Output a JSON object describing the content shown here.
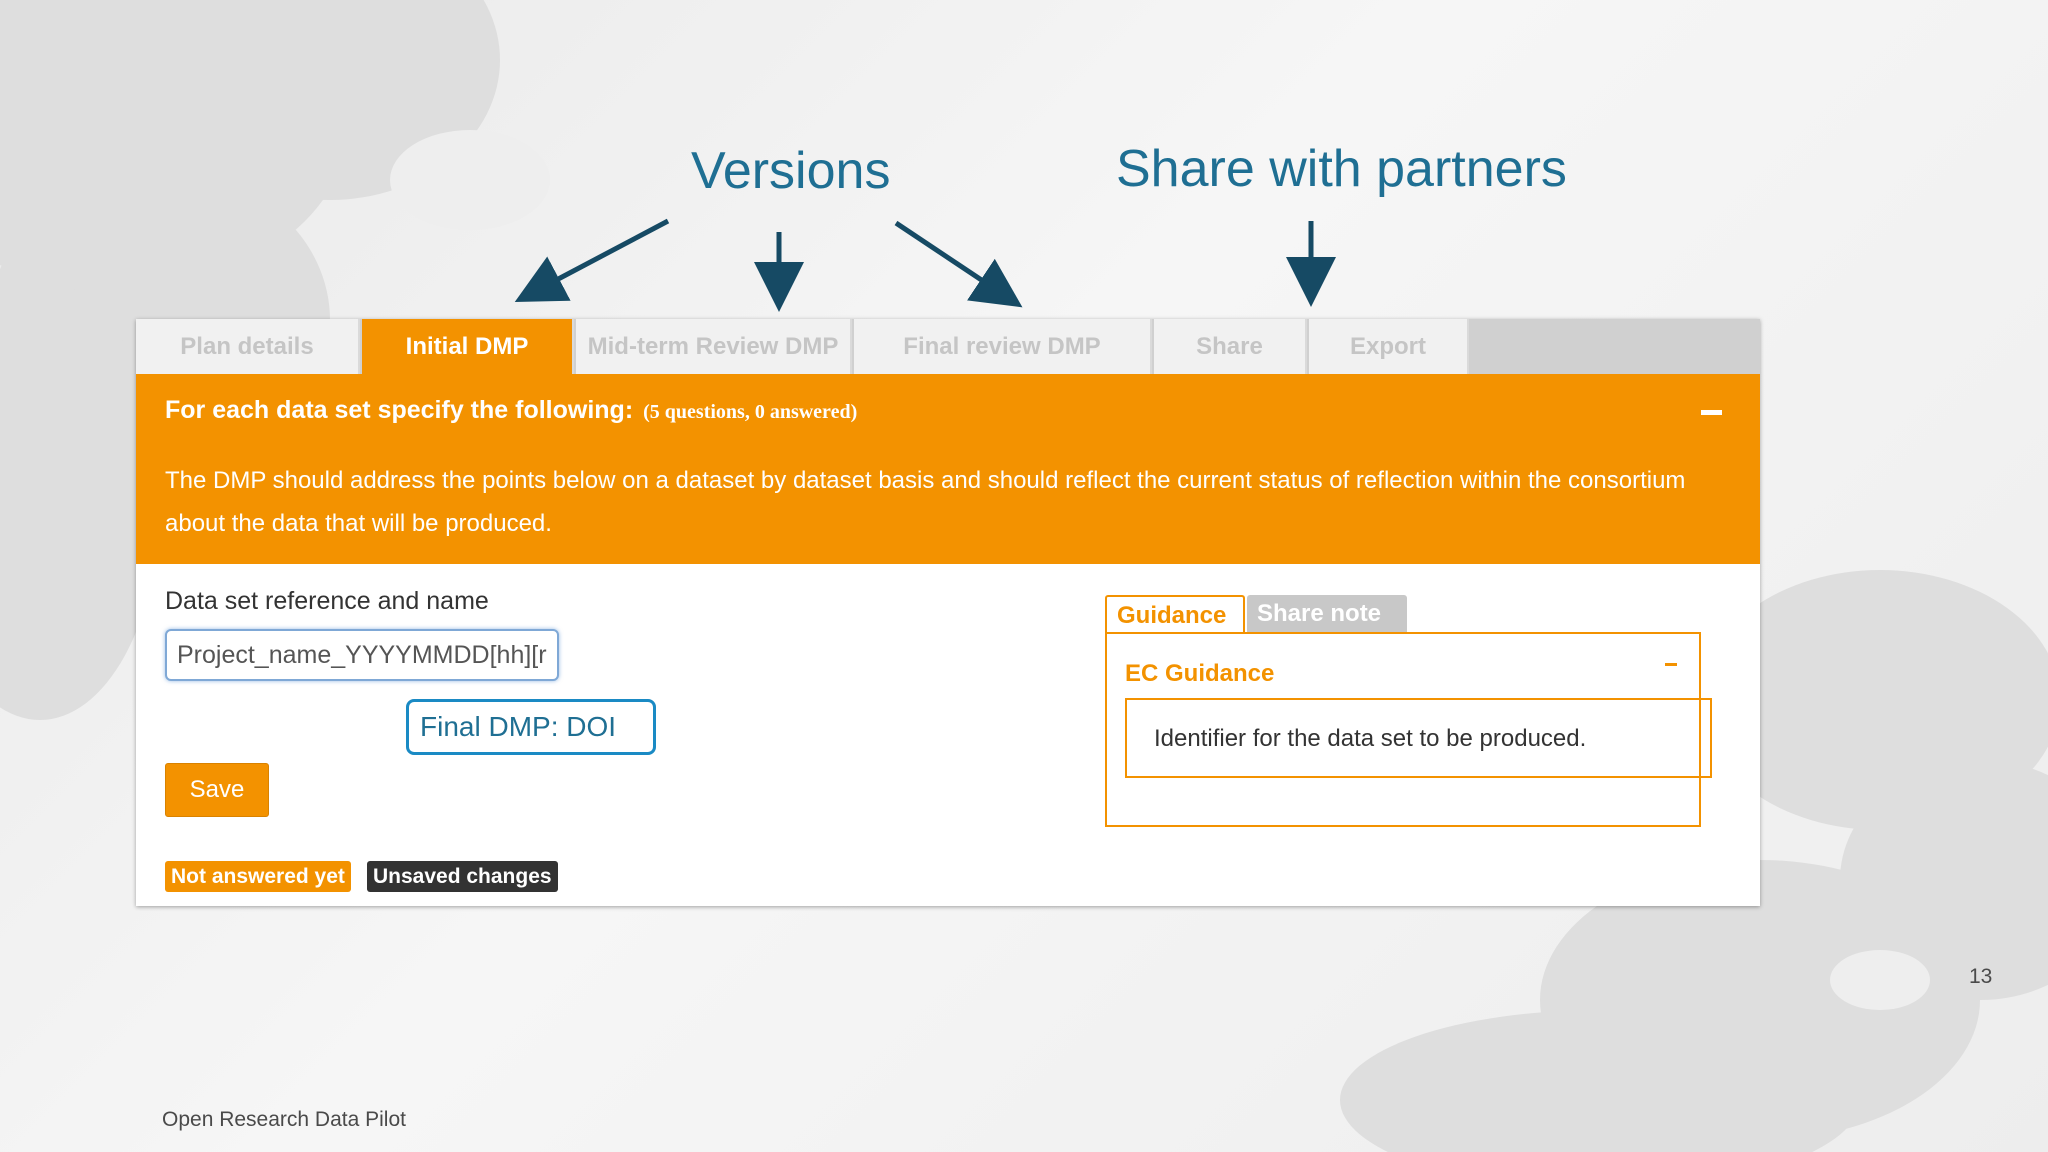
{
  "annotations": {
    "versions": "Versions",
    "share_with_partners": "Share with partners"
  },
  "tabs": [
    {
      "label": "Plan details",
      "active": false
    },
    {
      "label": "Initial DMP",
      "active": true
    },
    {
      "label": "Mid-term Review DMP",
      "active": false
    },
    {
      "label": "Final review DMP",
      "active": false
    },
    {
      "label": "Share",
      "active": false
    },
    {
      "label": "Export",
      "active": false
    }
  ],
  "section": {
    "title": "For each data set specify the following:",
    "count": "(5 questions, 0 answered)",
    "description": "The DMP should address the points below on a dataset by dataset basis and should reflect the current status of reflection within the consortium about the data that will be produced.",
    "collapse_icon": "minus-icon"
  },
  "question": {
    "label": "Data set reference and name",
    "value": "Project_name_YYYYMMDD[hh][r"
  },
  "callout": "Final DMP: DOI",
  "save_label": "Save",
  "status_badges": {
    "not_answered": "Not answered yet",
    "unsaved": "Unsaved changes"
  },
  "guidance": {
    "tab_guidance": "Guidance",
    "tab_share_note": "Share note",
    "title": "EC Guidance",
    "text": "Identifier for the data set to be produced."
  },
  "footer": "Open Research Data Pilot",
  "page_number": "13",
  "colors": {
    "accent": "#f39200",
    "annotation": "#1f6f93",
    "callout_border": "#1a8ac4",
    "badge_dark": "#333333"
  }
}
